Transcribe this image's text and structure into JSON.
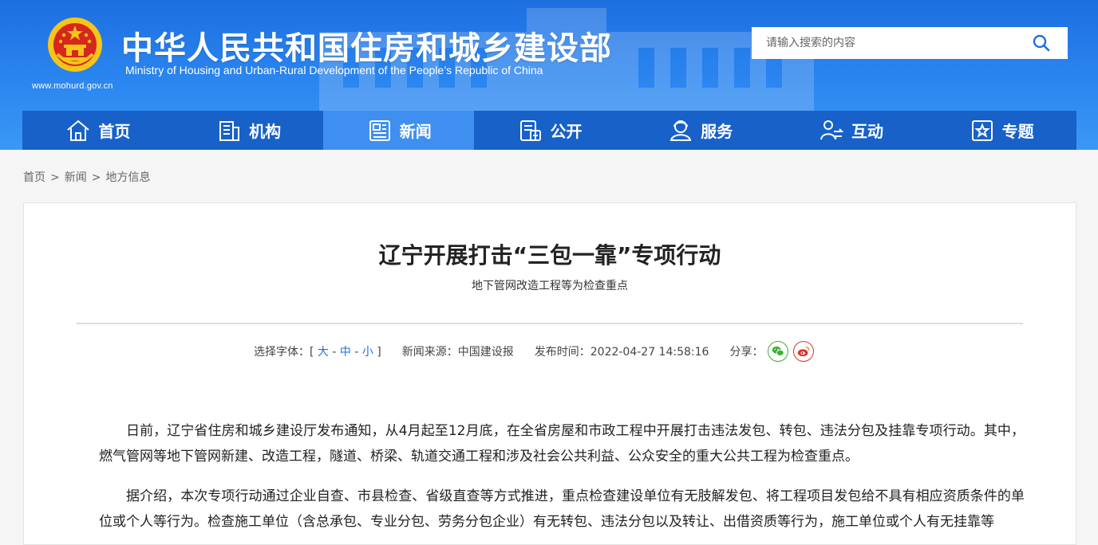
{
  "header": {
    "title_cn": "中华人民共和国住房和城乡建设部",
    "title_en": "Ministry of Housing and Urban-Rural Development of the People’s Republic of China",
    "site_url": "www.mohurd.gov.cn",
    "search_placeholder": "请输入搜索的内容"
  },
  "nav": {
    "items": [
      {
        "label": "首页",
        "icon": "home-icon"
      },
      {
        "label": "机构",
        "icon": "building-icon"
      },
      {
        "label": "新闻",
        "icon": "newspaper-icon",
        "active": true
      },
      {
        "label": "公开",
        "icon": "document-icon"
      },
      {
        "label": "服务",
        "icon": "service-icon"
      },
      {
        "label": "互动",
        "icon": "interact-icon"
      },
      {
        "label": "专题",
        "icon": "star-icon"
      }
    ]
  },
  "breadcrumb": [
    "首页",
    "新闻",
    "地方信息"
  ],
  "article": {
    "title": "辽宁开展打击“三包一靠”专项行动",
    "subtitle": "地下管网改造工程等为检查重点",
    "font_label": "选择字体：",
    "font_open": "[",
    "font_large": "大",
    "font_medium": "中",
    "font_small": "小",
    "font_close": "]",
    "source": "新闻来源：中国建设报",
    "date": "发布时间：2022-04-27 14:58:16",
    "share_label": "分享：",
    "paragraphs": [
      "日前，辽宁省住房和城乡建设厅发布通知，从4月起至12月底，在全省房屋和市政工程中开展打击违法发包、转包、违法分包及挂靠专项行动。其中，燃气管网等地下管网新建、改造工程，隧道、桥梁、轨道交通工程和涉及社会公共利益、公众安全的重大公共工程为检查重点。",
      "据介绍，本次专项行动通过企业自查、市县检查、省级直查等方式推进，重点检查建设单位有无肢解发包、将工程项目发包给不具有相应资质条件的单位或个人等行为。检查施工单位（含总承包、专业分包、劳务分包企业）有无转包、违法分包以及转让、出借资质等行为，施工单位或个人有无挂靠等"
    ]
  },
  "colors": {
    "header_blue": "#1d6fe0",
    "nav_blue": "#1761c9",
    "nav_active": "#3f8ff0"
  }
}
